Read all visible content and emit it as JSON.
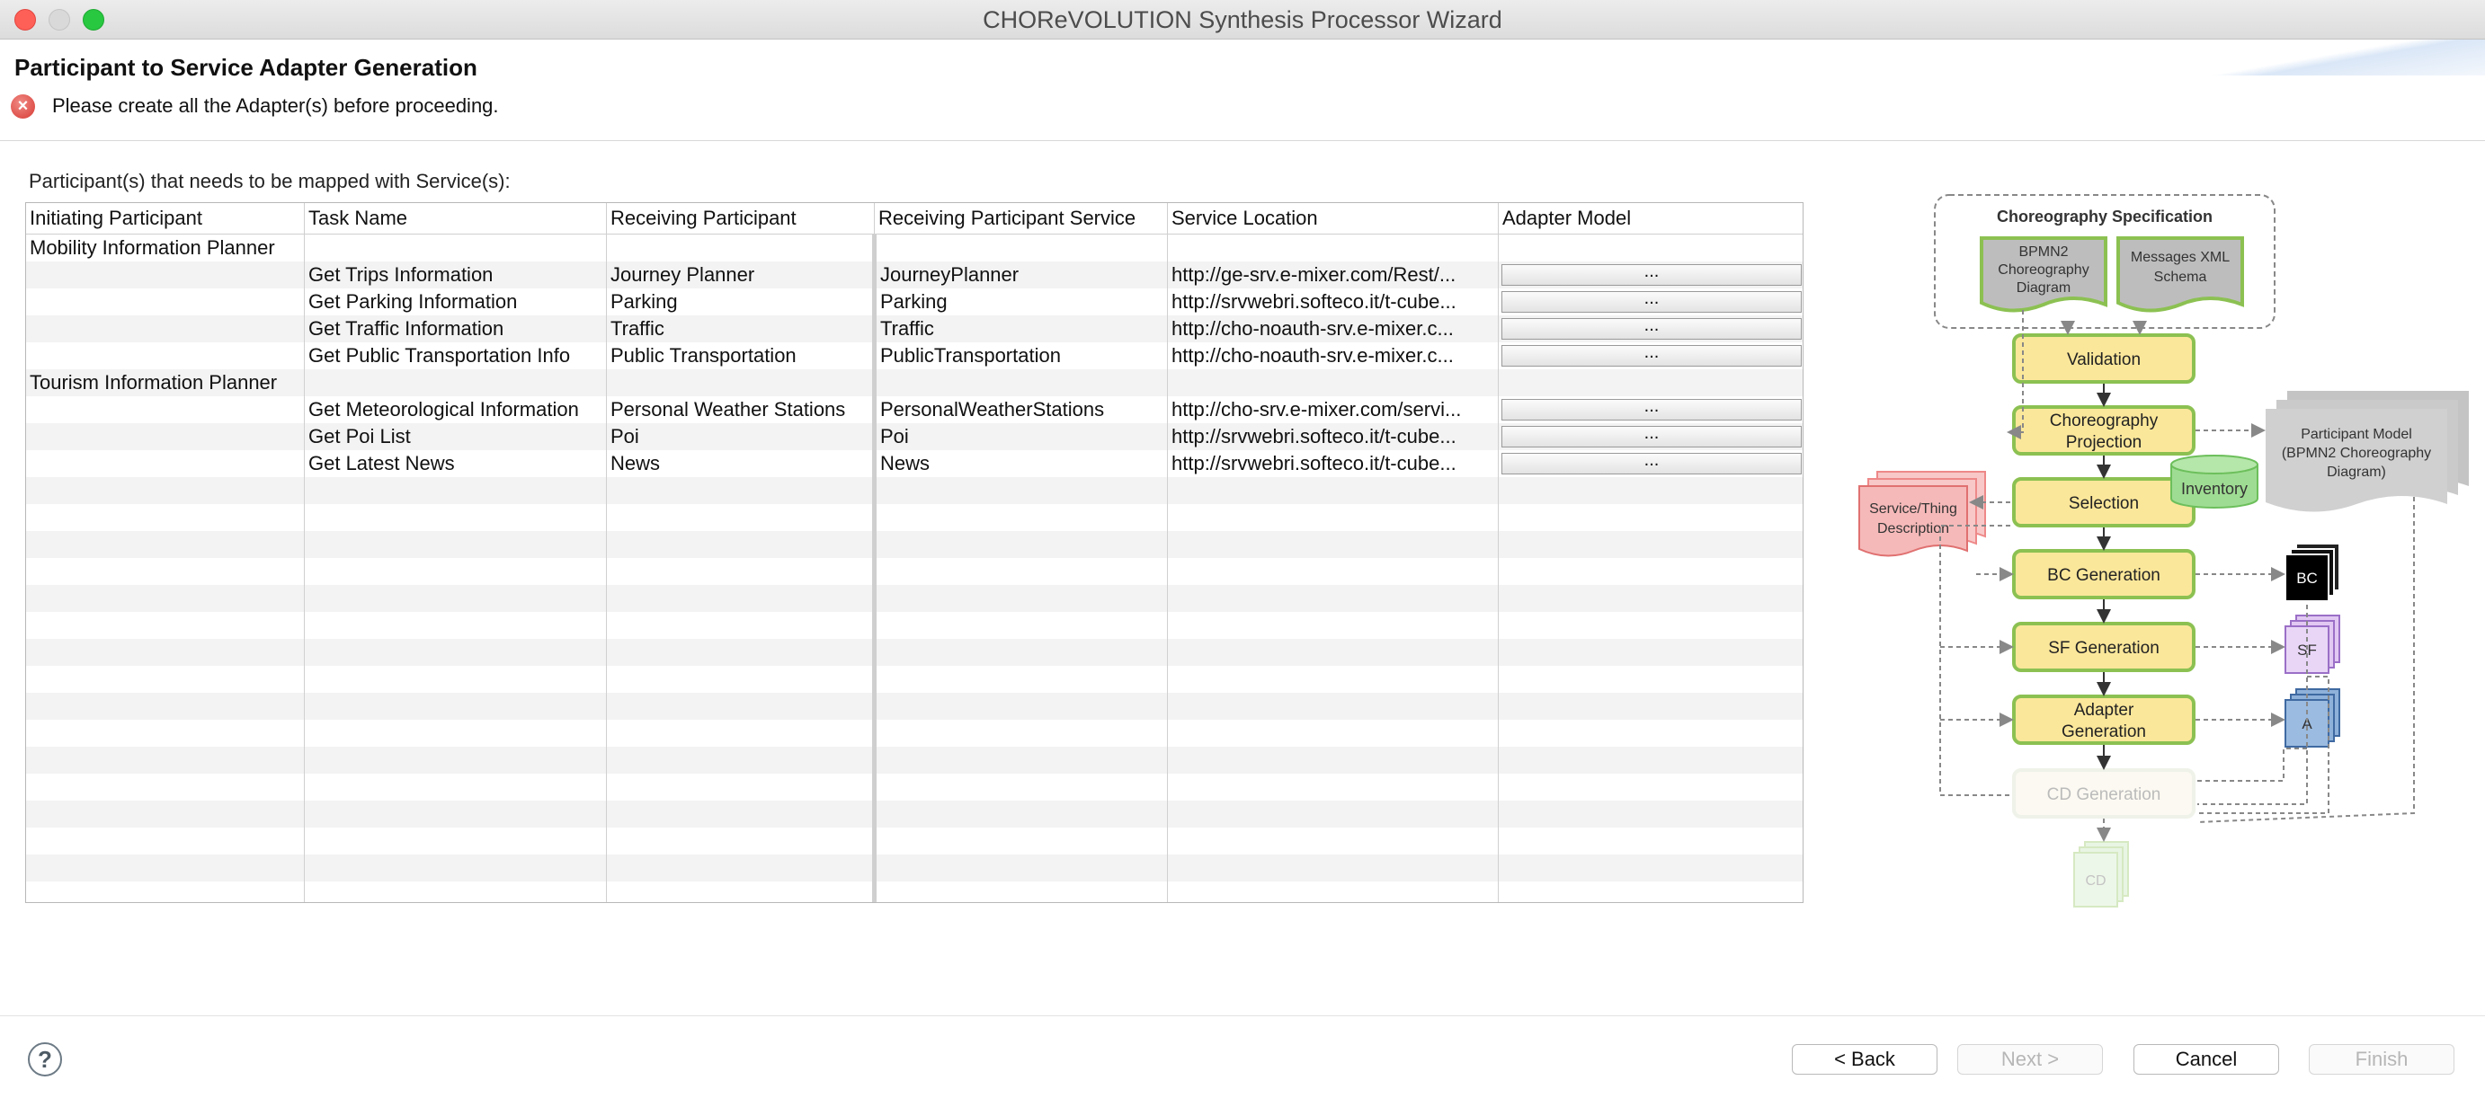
{
  "window": {
    "title": "CHOReVOLUTION Synthesis Processor Wizard"
  },
  "header": {
    "page_title": "Participant to Service Adapter Generation",
    "message": "Please create all the Adapter(s) before proceeding."
  },
  "table": {
    "label": "Participant(s) that needs to be mapped with Service(s):",
    "columns": [
      "Initiating Participant",
      "Task Name",
      "Receiving Participant",
      "Receiving Participant Service",
      "Service Location",
      "Adapter Model"
    ],
    "rows": [
      {
        "initiating": "Mobility Information Planner",
        "task": "",
        "receiving": "",
        "service": "",
        "location": "",
        "adapter": ""
      },
      {
        "initiating": "",
        "task": "Get Trips Information",
        "receiving": "Journey Planner",
        "service": "JourneyPlanner",
        "location": "http://ge-srv.e-mixer.com/Rest/...",
        "adapter": "..."
      },
      {
        "initiating": "",
        "task": "Get Parking Information",
        "receiving": "Parking",
        "service": "Parking",
        "location": "http://srvwebri.softeco.it/t-cube...",
        "adapter": "..."
      },
      {
        "initiating": "",
        "task": "Get Traffic Information",
        "receiving": "Traffic",
        "service": "Traffic",
        "location": "http://cho-noauth-srv.e-mixer.c...",
        "adapter": "..."
      },
      {
        "initiating": "",
        "task": "Get Public Transportation Info",
        "receiving": "Public Transportation",
        "service": "PublicTransportation",
        "location": "http://cho-noauth-srv.e-mixer.c...",
        "adapter": "..."
      },
      {
        "initiating": "Tourism Information Planner",
        "task": "",
        "receiving": "",
        "service": "",
        "location": "",
        "adapter": ""
      },
      {
        "initiating": "",
        "task": "Get Meteorological Information",
        "receiving": "Personal Weather Stations",
        "service": "PersonalWeatherStations",
        "location": "http://cho-srv.e-mixer.com/servi...",
        "adapter": "..."
      },
      {
        "initiating": "",
        "task": "Get Poi List",
        "receiving": "Poi",
        "service": "Poi",
        "location": "http://srvwebri.softeco.it/t-cube...",
        "adapter": "..."
      },
      {
        "initiating": "",
        "task": "Get Latest News",
        "receiving": "News",
        "service": "News",
        "location": "http://srvwebri.softeco.it/t-cube...",
        "adapter": "..."
      }
    ]
  },
  "diagram": {
    "spec_title": "Choreography  Specification",
    "bpmn_doc": [
      "BPMN2",
      "Choreography",
      "Diagram"
    ],
    "xml_doc": [
      "Messages XML",
      "Schema"
    ],
    "steps": [
      "Validation",
      "Choreography|Projection",
      "Selection",
      "BC Generation",
      "SF Generation",
      "Adapter|Generation",
      "CD Generation"
    ],
    "inventory": "Inventory",
    "service_desc": [
      "Service/Thing",
      "Description"
    ],
    "participant_model": [
      "Participant Model",
      "(BPMN2 Choreography",
      "Diagram)"
    ],
    "artifacts": {
      "bc": "BC",
      "sf": "SF",
      "a": "A",
      "cd": "CD"
    }
  },
  "buttons": {
    "help": "?",
    "back": "< Back",
    "next": "Next >",
    "cancel": "Cancel",
    "finish": "Finish"
  },
  "colors": {
    "step_fill": "#fbe79a",
    "step_border": "#8cc152",
    "error": "#d83a33"
  }
}
